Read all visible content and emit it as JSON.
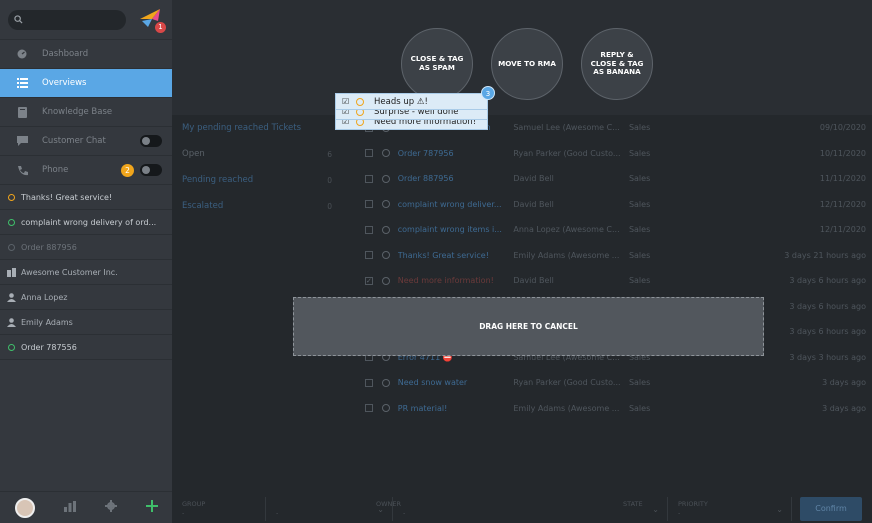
{
  "sidebar": {
    "logo_badge": "1",
    "nav": [
      {
        "label": "Dashboard",
        "icon": "dashboard-icon"
      },
      {
        "label": "Overviews",
        "icon": "list-icon",
        "active": true
      },
      {
        "label": "Knowledge Base",
        "icon": "book-icon"
      },
      {
        "label": "Customer Chat",
        "icon": "chat-icon"
      },
      {
        "label": "Phone",
        "icon": "phone-icon",
        "badge": "2"
      }
    ],
    "recent": [
      {
        "label": "Thanks! Great service!",
        "icon": "status-ring-icon",
        "color": "#f0a51c"
      },
      {
        "label": "complaint wrong delivery of ord...",
        "icon": "status-ring-icon",
        "color": "#3fbf6a"
      },
      {
        "label": "Order 887956",
        "icon": "status-ring-icon",
        "color": "#5a6168"
      },
      {
        "label": "Awesome Customer Inc.",
        "icon": "organization-icon"
      },
      {
        "label": "Anna Lopez",
        "icon": "user-icon"
      },
      {
        "label": "Emily Adams",
        "icon": "user-icon"
      },
      {
        "label": "Order 787556",
        "icon": "status-ring-icon",
        "color": "#3fbf6a"
      }
    ]
  },
  "macros": [
    {
      "label": "CLOSE & TAG\nAS SPAM"
    },
    {
      "label": "MOVE TO RMA"
    },
    {
      "label": "REPLY &\nCLOSE & TAG\nAS BANANA"
    }
  ],
  "overviews": [
    {
      "label": "My pending reached Tickets",
      "count": ""
    },
    {
      "label": "Open",
      "count": "6"
    },
    {
      "label": "Pending reached",
      "count": "0"
    },
    {
      "label": "Escalated",
      "count": "0"
    }
  ],
  "tickets": [
    {
      "title": "Need more information",
      "customer": "Samuel Lee (Awesome C...",
      "group": "Sales",
      "date": "09/10/2020",
      "checked": false
    },
    {
      "title": "Order 787956",
      "customer": "Ryan Parker (Good Custo...",
      "group": "Sales",
      "date": "10/11/2020",
      "checked": false
    },
    {
      "title": "Order 887956",
      "customer": "David Bell",
      "group": "Sales",
      "date": "11/11/2020",
      "checked": false
    },
    {
      "title": "complaint wrong deliver...",
      "customer": "David Bell",
      "group": "Sales",
      "date": "12/11/2020",
      "checked": false
    },
    {
      "title": "complaint wrong items i...",
      "customer": "Anna Lopez (Awesome C...",
      "group": "Sales",
      "date": "12/11/2020",
      "checked": false
    },
    {
      "title": "Thanks! Great service!",
      "customer": "Emily Adams (Awesome ...",
      "group": "Sales",
      "date": "3 days 21 hours ago",
      "checked": false
    },
    {
      "title": "Need more information!",
      "customer": "David Bell",
      "group": "Sales",
      "date": "3 days 6 hours ago",
      "checked": true
    },
    {
      "title": "Heads up ⚠!",
      "customer": "Olivia Ross",
      "group": "Sales",
      "date": "3 days 6 hours ago",
      "checked": true
    },
    {
      "title": "Surprise - well done",
      "customer": "Anna Lopez (Awesome C...",
      "group": "Sales",
      "date": "3 days 6 hours ago",
      "checked": true
    },
    {
      "title": "Error 4711 ⛔",
      "customer": "Samuel Lee (Awesome C...",
      "group": "Sales",
      "date": "3 days 3 hours ago",
      "checked": false
    },
    {
      "title": "Need snow water",
      "customer": "Ryan Parker (Good Custo...",
      "group": "Sales",
      "date": "3 days ago",
      "checked": false
    },
    {
      "title": "PR material!",
      "customer": "Emily Adams (Awesome ...",
      "group": "Sales",
      "date": "3 days ago",
      "checked": false
    }
  ],
  "cancel_zone": {
    "label": "DRAG HERE TO CANCEL"
  },
  "drag_preview": {
    "count": "3",
    "items": [
      "Heads up ⚠!",
      "Surprise - well done",
      "Need more information!"
    ]
  },
  "bulk_bar": {
    "selects": [
      {
        "label": "GROUP",
        "value": "-"
      },
      {
        "label": "OWNER",
        "value": "-"
      },
      {
        "label": "STATE",
        "value": "-"
      },
      {
        "label": "PRIORITY",
        "value": "-"
      }
    ],
    "confirm_label": "Confirm"
  },
  "colors": {
    "accent": "#5aa7e5",
    "warning": "#f0a51c",
    "ok": "#3fbf6a"
  }
}
